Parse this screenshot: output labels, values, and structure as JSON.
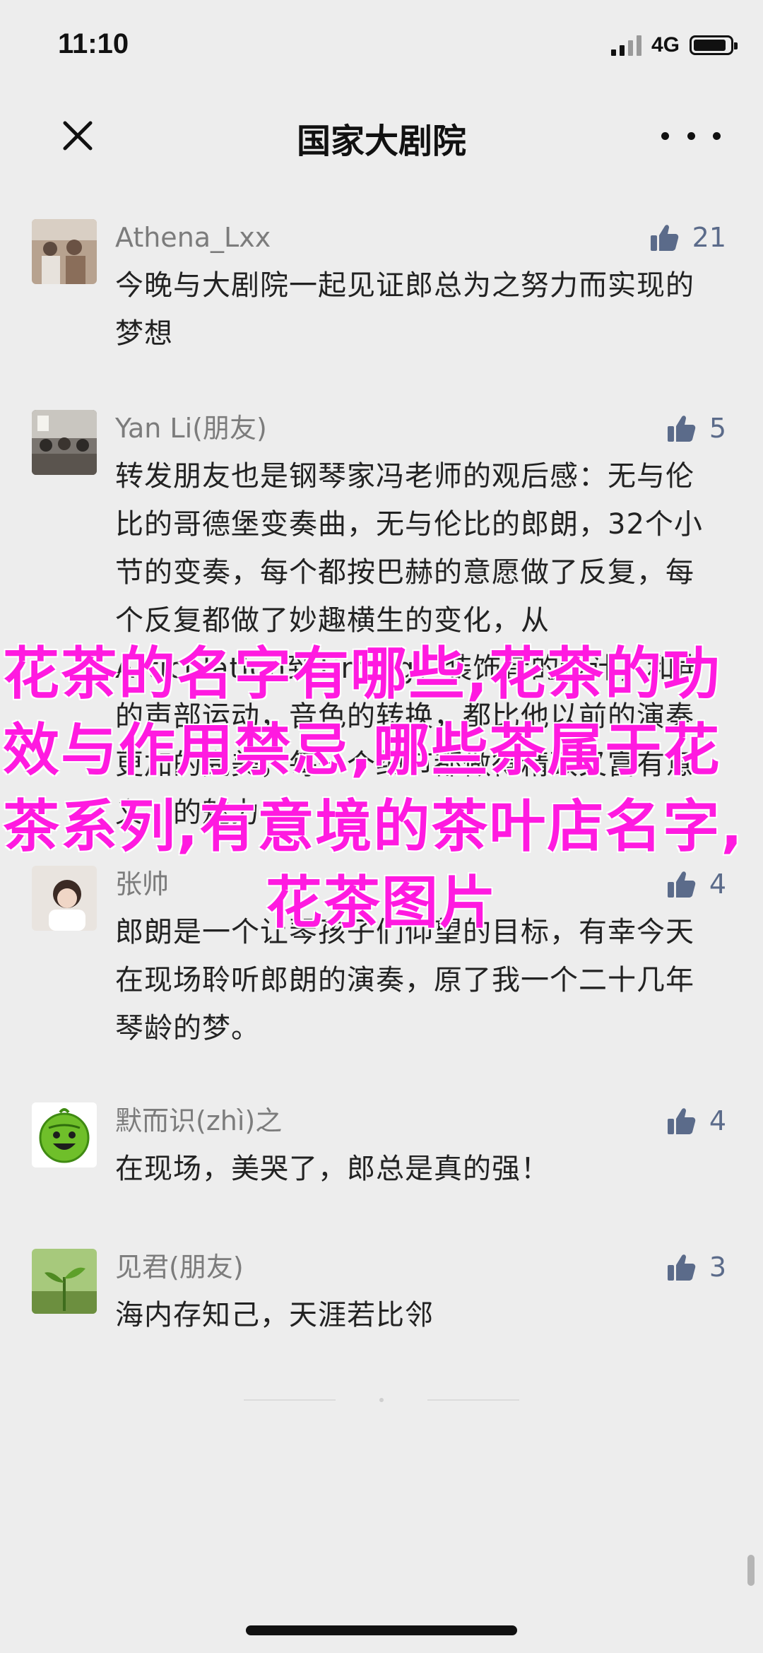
{
  "status_bar": {
    "time": "11:10",
    "network": "4G"
  },
  "nav": {
    "title": "国家大剧院"
  },
  "comments": [
    {
      "name": "Athena_Lxx",
      "likes": "21",
      "text": "今晚与大剧院一起见证郎总为之努力而实现的梦想"
    },
    {
      "name": "Yan Li(朋友)",
      "likes": "5",
      "text": "转发朋友也是钢琴家冯老师的观后感：无与伦比的哥德堡变奏曲，无与伦比的郎朗，32个小节的变奏，每个都按巴赫的意愿做了反复，每个反复都做了妙趣横生的变化，从Articulation到Timing，装饰音的设计，和声的声部运动，音色的转换，都比他以前的演奏更加的完美，每一个细节都做得精致又富有意义…的魅力"
    },
    {
      "name": "张帅",
      "likes": "4",
      "text": "郎朗是一个让琴孩子们仰望的目标，有幸今天在现场聆听郎朗的演奏，原了我一个二十几年琴龄的梦。"
    },
    {
      "name": "默而识(zhì)之",
      "likes": "4",
      "text": "在现场，美哭了，郎总是真的强！"
    },
    {
      "name": "见君(朋友)",
      "likes": "3",
      "text": "海内存知己，天涯若比邻"
    }
  ],
  "overlay": {
    "text": "花茶的名字有哪些,花茶的功效与作用禁忌,哪些茶属于花茶系列,有意境的茶叶店名字,",
    "last_line": "花茶图片"
  },
  "colors": {
    "background": "#ededed",
    "overlay_text": "#ff1ae0",
    "like_icon": "#5b6b8a"
  }
}
